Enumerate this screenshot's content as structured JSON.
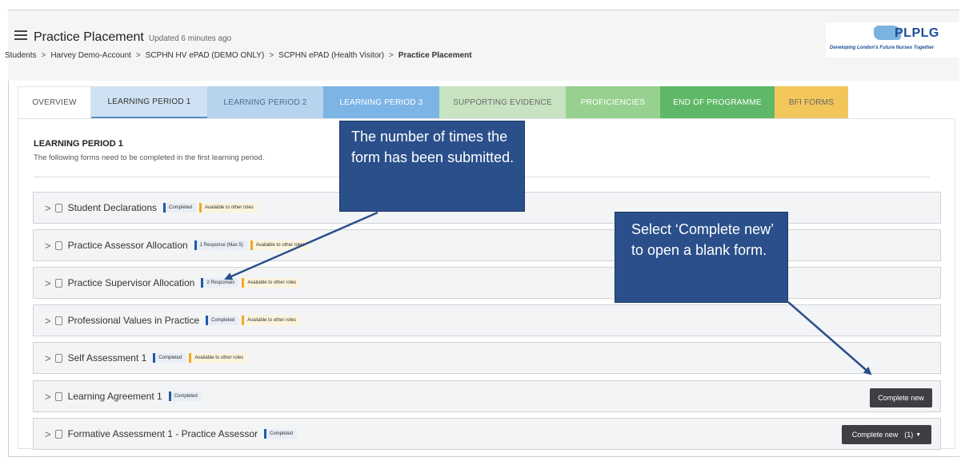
{
  "header": {
    "title": "Practice Placement",
    "updated": "Updated 6 minutes ago",
    "breadcrumb": [
      "Students",
      "Harvey Demo-Account",
      "SCPHN HV ePAD (DEMO ONLY)",
      "SCPHN ePAD (Health Visitor)",
      "Practice Placement"
    ],
    "breadcrumb_sep": ">",
    "logo": {
      "brand": "PLPLG",
      "tagline": "Developing London's Future Nurses Together"
    }
  },
  "tabs": [
    "OVERVIEW",
    "LEARNING PERIOD 1",
    "LEARNING PERIOD 2",
    "LEARNING PERIOD 3",
    "SUPPORTING EVIDENCE",
    "PROFICIENCIES",
    "END OF PROGRAMME",
    "BFI FORMS"
  ],
  "section": {
    "title": "LEARNING PERIOD 1",
    "description": "The following forms need to be completed in the first learning period."
  },
  "forms": [
    {
      "label": "Student Declarations",
      "badges": [
        "Completed",
        "Available to other roles"
      ]
    },
    {
      "label": "Practice Assessor Allocation",
      "badges": [
        "1 Response (Max 5)",
        "Available to other roles"
      ]
    },
    {
      "label": "Practice Supervisor Allocation",
      "badges": [
        "2 Responses",
        "Available to other roles"
      ]
    },
    {
      "label": "Professional Values in Practice",
      "badges": [
        "Completed",
        "Available to other roles"
      ]
    },
    {
      "label": "Self Assessment 1",
      "badges": [
        "Completed",
        "Available to other roles"
      ]
    },
    {
      "label": "Learning Agreement 1",
      "badges": [
        "Completed"
      ]
    },
    {
      "label": "Formative Assessment 1 - Practice Assessor",
      "badges": [
        "Completed"
      ]
    }
  ],
  "buttons": {
    "complete_new": "Complete new",
    "complete_new_count": "(1)"
  },
  "callouts": {
    "submitted": "The number of times the form has been submitted.",
    "complete_new": "Select ‘Complete new’ to open a blank form."
  },
  "icons": {
    "menu": "list-icon",
    "chevron": "chevron-right-icon",
    "document": "document-icon",
    "caret": "caret-down-icon"
  },
  "colors": {
    "callout_bg": "#2a4f8a",
    "badge_blue": "#1e5aa8",
    "badge_yellow": "#f0a826",
    "button_bg": "#3d3f44",
    "tab_lp1": "#cfe2f3",
    "tab_lp2": "#b7d3ee",
    "tab_lp3": "#7db4e6",
    "tab_supporting": "#c7e3c2",
    "tab_proficiencies": "#97d18f",
    "tab_end": "#5fb868",
    "tab_bfi": "#f3c65c"
  }
}
